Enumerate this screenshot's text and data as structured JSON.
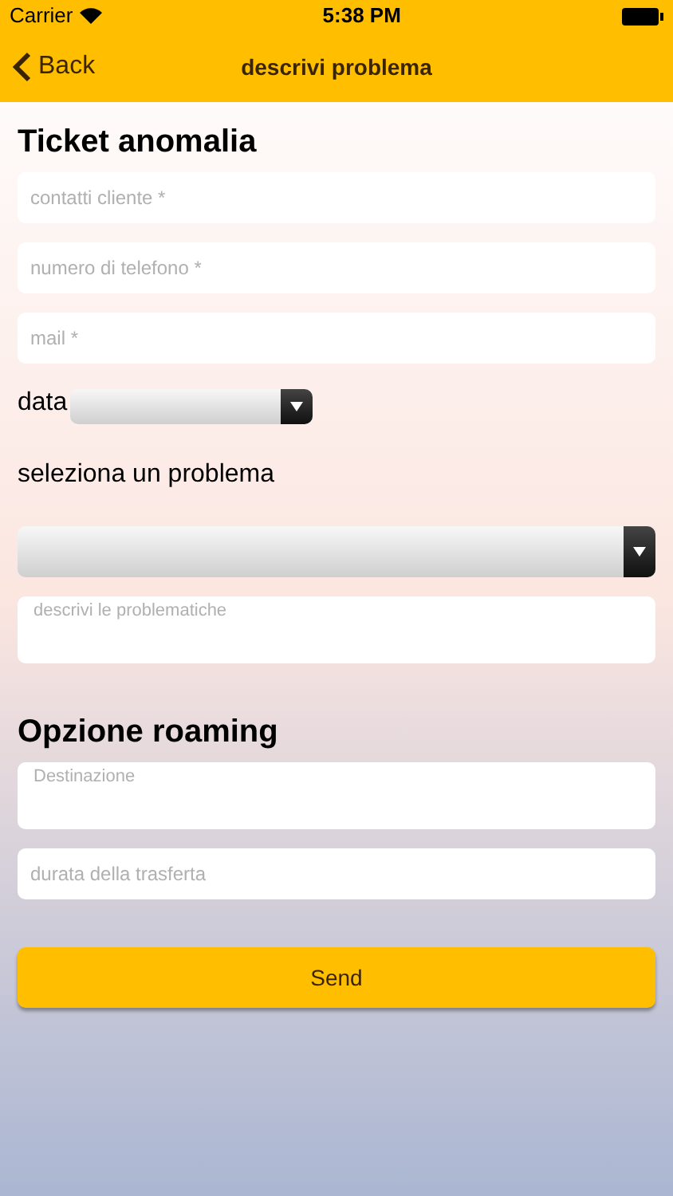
{
  "status_bar": {
    "carrier": "Carrier",
    "time": "5:38 PM"
  },
  "nav_bar": {
    "back": "Back",
    "title": "descrivi problema"
  },
  "sections": [
    {
      "title": "Ticket anomalia",
      "items": [
        {
          "kind": "field",
          "placeholder": "contatti cliente *"
        },
        {
          "kind": "field",
          "placeholder": "numero di telefono *"
        },
        {
          "kind": "field",
          "placeholder": "mail *"
        },
        {
          "kind": "inline_dropdown",
          "label": "data"
        },
        {
          "kind": "label",
          "text": "seleziona un problema"
        },
        {
          "kind": "dropdown"
        },
        {
          "kind": "textarea",
          "placeholder": "descrivi le problematiche"
        }
      ]
    },
    {
      "title": "Opzione roaming",
      "items": [
        {
          "kind": "textarea",
          "placeholder": "Destinazione"
        },
        {
          "kind": "field",
          "placeholder": "durata della trasferta"
        }
      ]
    }
  ],
  "send_button": "Send"
}
